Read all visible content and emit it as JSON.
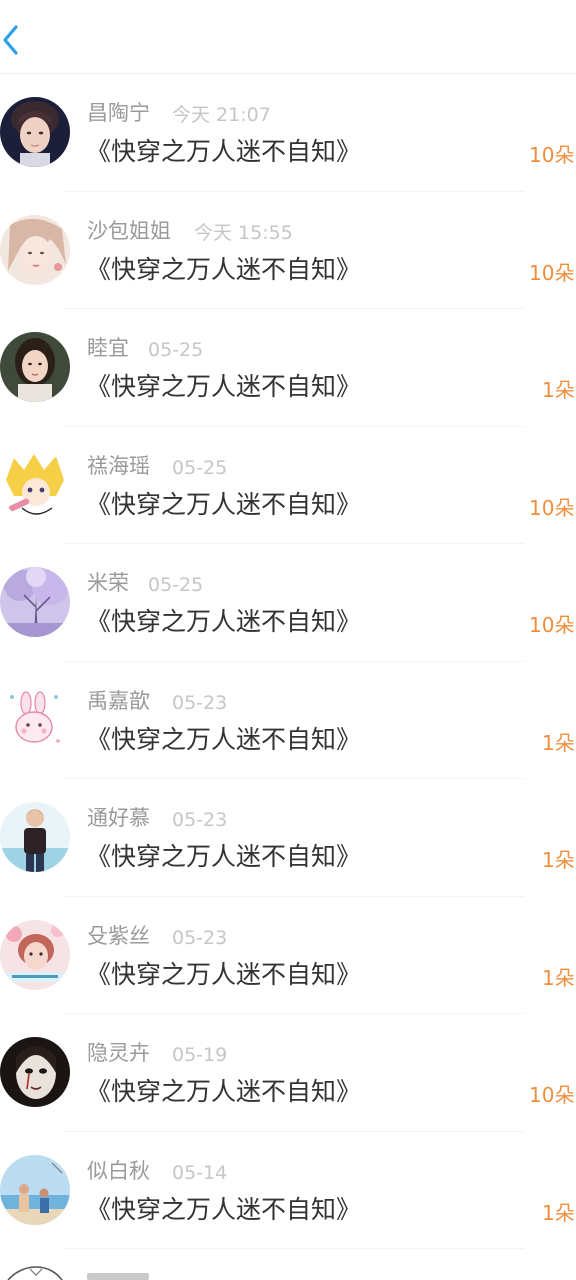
{
  "header": {
    "back_icon": "chevron-left-icon",
    "accent_color": "#2aa0e8"
  },
  "colors": {
    "name": "#9a9a9a",
    "time": "#c6c6c6",
    "title": "#333333",
    "count": "#ef8f3e"
  },
  "entries": [
    {
      "name": "昌陶宁",
      "time": "今天 21:07",
      "title": "《快穿之万人迷不自知》",
      "count": "10朵",
      "avatar": "avatar-boy-portrait-icon"
    },
    {
      "name": "沙包姐姐",
      "time": "今天 15:55",
      "title": "《快穿之万人迷不自知》",
      "count": "10朵",
      "avatar": "avatar-girl-illustration-icon"
    },
    {
      "name": "睦宜",
      "time": "05-25",
      "title": "《快穿之万人迷不自知》",
      "count": "1朵",
      "avatar": "avatar-woman-photo-icon"
    },
    {
      "name": "禚海瑶",
      "time": "05-25",
      "title": "《快穿之万人迷不自知》",
      "count": "10朵",
      "avatar": "avatar-anime-blonde-icon"
    },
    {
      "name": "米荣",
      "time": "05-25",
      "title": "《快穿之万人迷不自知》",
      "count": "10朵",
      "avatar": "avatar-purple-tree-icon"
    },
    {
      "name": "禹嘉歆",
      "time": "05-23",
      "title": "《快穿之万人迷不自知》",
      "count": "1朵",
      "avatar": "avatar-pink-bunny-icon"
    },
    {
      "name": "通好慕",
      "time": "05-23",
      "title": "《快穿之万人迷不自知》",
      "count": "1朵",
      "avatar": "avatar-man-standing-icon"
    },
    {
      "name": "殳紫丝",
      "time": "05-23",
      "title": "《快穿之万人迷不自知》",
      "count": "1朵",
      "avatar": "avatar-boy-flowers-icon"
    },
    {
      "name": "隐灵卉",
      "time": "05-19",
      "title": "《快穿之万人迷不自知》",
      "count": "10朵",
      "avatar": "avatar-dark-face-icon"
    },
    {
      "name": "似白秋",
      "time": "05-14",
      "title": "《快穿之万人迷不自知》",
      "count": "1朵",
      "avatar": "avatar-beach-people-icon"
    }
  ]
}
